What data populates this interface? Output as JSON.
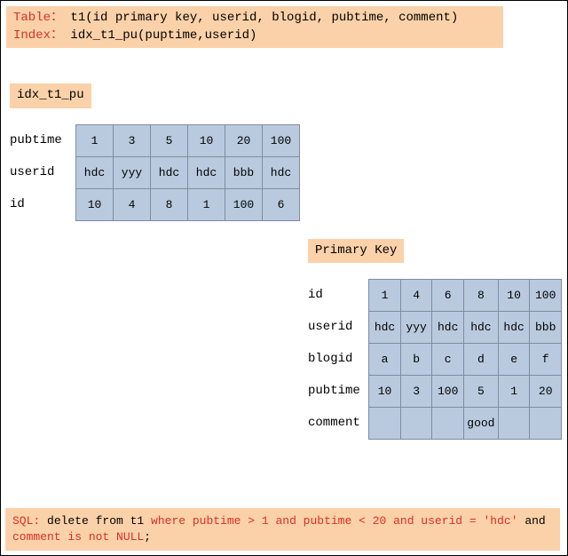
{
  "header": {
    "table_label": "Table：",
    "table_def": "t1(id primary key, userid, blogid, pubtime, comment)",
    "index_label": "Index：",
    "index_def": "idx_t1_pu(puptime,userid)"
  },
  "idx_section": {
    "title": "idx_t1_pu",
    "row_labels": [
      "pubtime",
      "userid",
      "id"
    ],
    "rows": [
      [
        "1",
        "3",
        "5",
        "10",
        "20",
        "100"
      ],
      [
        "hdc",
        "yyy",
        "hdc",
        "hdc",
        "bbb",
        "hdc"
      ],
      [
        "10",
        "4",
        "8",
        "1",
        "100",
        "6"
      ]
    ]
  },
  "pk_section": {
    "title": "Primary Key",
    "row_labels": [
      "id",
      "userid",
      "blogid",
      "pubtime",
      "comment"
    ],
    "rows": [
      [
        "1",
        "4",
        "6",
        "8",
        "10",
        "100"
      ],
      [
        "hdc",
        "yyy",
        "hdc",
        "hdc",
        "hdc",
        "bbb"
      ],
      [
        "a",
        "b",
        "c",
        "d",
        "e",
        "f"
      ],
      [
        "10",
        "3",
        "100",
        "5",
        "1",
        "20"
      ],
      [
        "",
        "",
        "",
        "good",
        "",
        ""
      ]
    ]
  },
  "sql": {
    "prefix": "SQL:",
    "black1": " delete from t1 ",
    "red1": "where pubtime > 1 and pubtime < 20 and userid =  'hdc'",
    "black2": " and ",
    "red2": "comment is not NULL",
    "black3": ";"
  }
}
